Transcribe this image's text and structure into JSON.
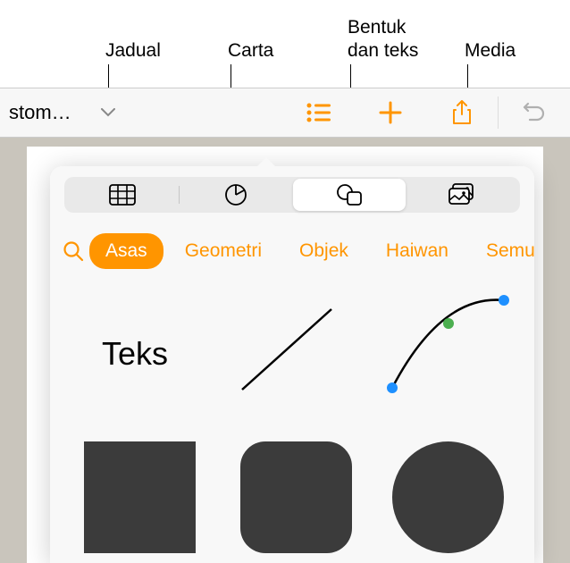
{
  "callouts": {
    "jadual": "Jadual",
    "carta": "Carta",
    "bentuk_line1": "Bentuk",
    "bentuk_line2": "dan teks",
    "media": "Media"
  },
  "toolbar": {
    "title": "stom…"
  },
  "categories": {
    "asas": "Asas",
    "geometri": "Geometri",
    "objek": "Objek",
    "haiwan": "Haiwan",
    "semua": "Semu"
  },
  "shapes": {
    "text_label": "Teks"
  }
}
